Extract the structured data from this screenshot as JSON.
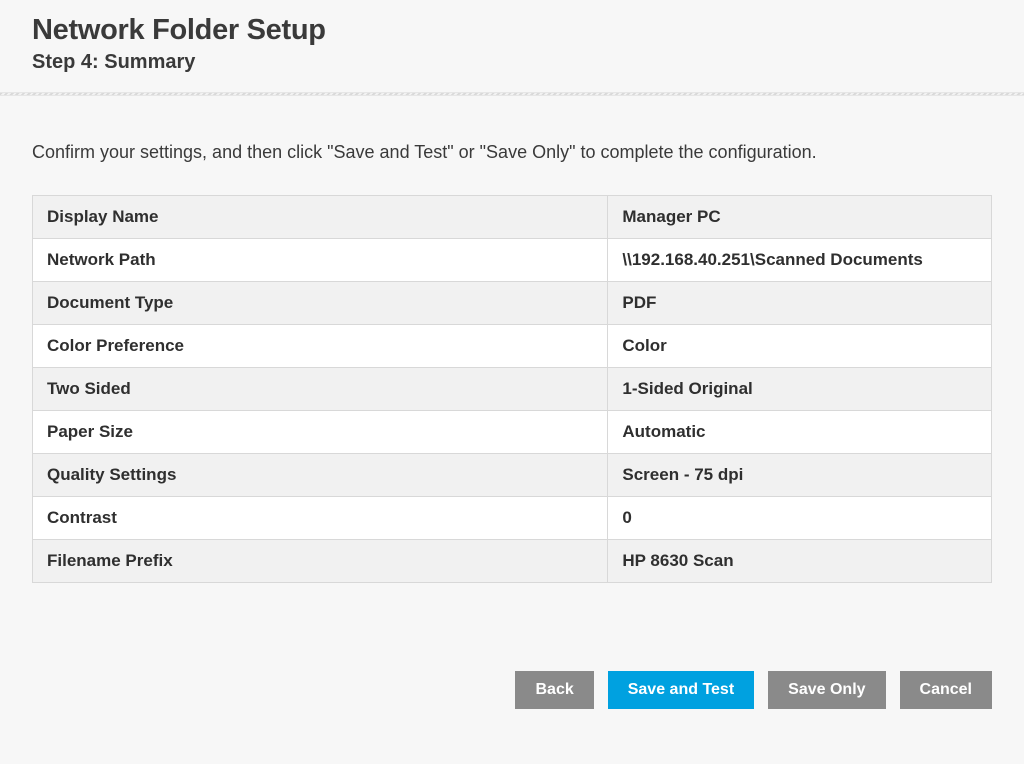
{
  "header": {
    "title": "Network Folder Setup",
    "subtitle": "Step 4: Summary"
  },
  "instruction": "Confirm your settings, and then click \"Save and Test\" or \"Save Only\" to complete the configuration.",
  "settings": [
    {
      "label": "Display Name",
      "value": "Manager PC"
    },
    {
      "label": "Network Path",
      "value": "\\\\192.168.40.251\\Scanned Documents"
    },
    {
      "label": "Document Type",
      "value": "PDF"
    },
    {
      "label": "Color Preference",
      "value": "Color"
    },
    {
      "label": "Two Sided",
      "value": "1-Sided Original"
    },
    {
      "label": "Paper Size",
      "value": "Automatic"
    },
    {
      "label": "Quality Settings",
      "value": "Screen - 75 dpi"
    },
    {
      "label": "Contrast",
      "value": "0"
    },
    {
      "label": "Filename Prefix",
      "value": "HP 8630 Scan"
    }
  ],
  "buttons": {
    "back": "Back",
    "save_and_test": "Save and Test",
    "save_only": "Save Only",
    "cancel": "Cancel"
  }
}
